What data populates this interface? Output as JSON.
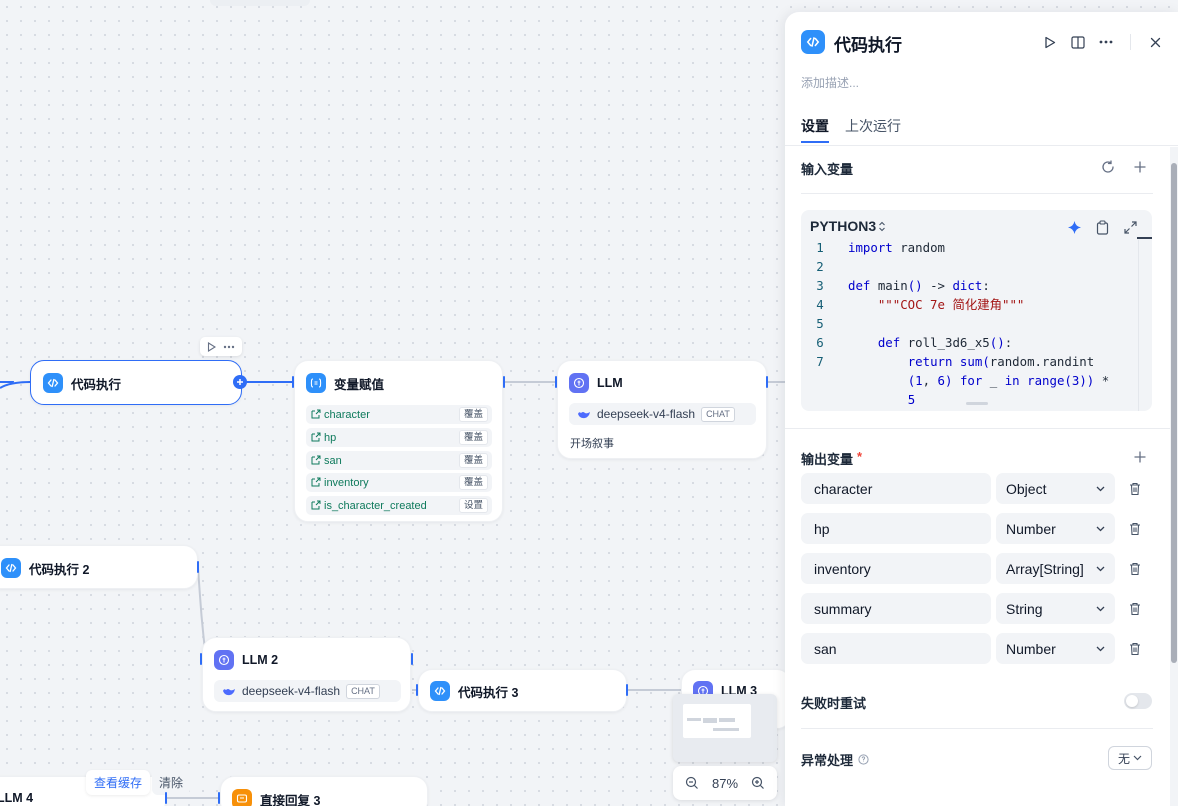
{
  "canvas": {
    "nodes": {
      "code1": {
        "title": "代码执行"
      },
      "assign": {
        "title": "变量赋值",
        "rows": [
          {
            "name": "character",
            "op": "覆盖"
          },
          {
            "name": "hp",
            "op": "覆盖"
          },
          {
            "name": "san",
            "op": "覆盖"
          },
          {
            "name": "inventory",
            "op": "覆盖"
          },
          {
            "name": "is_character_created",
            "op": "设置"
          }
        ]
      },
      "llm1": {
        "title": "LLM",
        "model": "deepseek-v4-flash",
        "mode": "CHAT",
        "desc": "开场叙事"
      },
      "code2": {
        "title": "代码执行 2"
      },
      "llm2": {
        "title": "LLM 2",
        "model": "deepseek-v4-flash",
        "mode": "CHAT"
      },
      "code3": {
        "title": "代码执行 3"
      },
      "llm3": {
        "title": "LLM 3"
      },
      "llm4": {
        "title": "LLM 4"
      },
      "reply3": {
        "title": "直接回复 3"
      }
    },
    "cache_link": "查看缓存",
    "clear_link": "清除",
    "zoom": "87%"
  },
  "panel": {
    "title": "代码执行",
    "description_placeholder": "添加描述...",
    "tabs": [
      {
        "label": "设置",
        "active": true
      },
      {
        "label": "上次运行",
        "active": false
      }
    ],
    "input_vars_label": "输入变量",
    "editor": {
      "language": "PYTHON3",
      "lines": [
        {
          "n": "1",
          "segs": [
            [
              "kw",
              "import"
            ],
            [
              "",
              " random"
            ]
          ]
        },
        {
          "n": "2",
          "segs": []
        },
        {
          "n": "3",
          "segs": [
            [
              "kw",
              "def"
            ],
            [
              "",
              " main"
            ],
            [
              "kw",
              "()"
            ],
            [
              "",
              " -> "
            ],
            [
              "kw",
              "dict"
            ],
            [
              "",
              ":"
            ]
          ]
        },
        {
          "n": "4",
          "segs": [
            [
              "",
              "    "
            ],
            [
              "str",
              "\"\"\"COC 7e 简化建角\"\"\""
            ]
          ]
        },
        {
          "n": "5",
          "segs": []
        },
        {
          "n": "6",
          "segs": [
            [
              "",
              "    "
            ],
            [
              "kw",
              "def"
            ],
            [
              "",
              " roll_3d6_x5"
            ],
            [
              "kw",
              "()"
            ],
            [
              "",
              ":"
            ]
          ]
        },
        {
          "n": "7",
          "segs": [
            [
              "",
              "        "
            ],
            [
              "kw",
              "return"
            ],
            [
              "",
              " "
            ],
            [
              "kw",
              "sum"
            ],
            [
              "kw",
              "("
            ],
            [
              "",
              "random.randint"
            ]
          ]
        },
        {
          "n": "",
          "segs": [
            [
              "",
              "        "
            ],
            [
              "kw",
              "(1"
            ],
            [
              "",
              ", "
            ],
            [
              "kw",
              "6"
            ],
            [
              "kw",
              ")"
            ],
            [
              "",
              " "
            ],
            [
              "kw",
              "for"
            ],
            [
              "",
              " _ "
            ],
            [
              "kw",
              "in"
            ],
            [
              "",
              " "
            ],
            [
              "kw",
              "range"
            ],
            [
              "kw",
              "(3))"
            ],
            [
              "",
              " *"
            ]
          ]
        },
        {
          "n": "",
          "segs": [
            [
              "",
              "        "
            ],
            [
              "kw",
              "5"
            ]
          ]
        }
      ]
    },
    "output_vars_label": "输出变量",
    "required_mark": "*",
    "outputs": [
      {
        "name": "character",
        "type": "Object"
      },
      {
        "name": "hp",
        "type": "Number"
      },
      {
        "name": "inventory",
        "type": "Array[String]"
      },
      {
        "name": "summary",
        "type": "String"
      },
      {
        "name": "san",
        "type": "Number"
      }
    ],
    "retry_label": "失败时重试",
    "retry_enabled": false,
    "error_label": "异常处理",
    "error_value": "无"
  },
  "colors": {
    "accent": "#2f6df6",
    "code_node_icon": "#2e90fa",
    "llm_node_icon": "#6172f3",
    "reply_node_icon": "#f79009",
    "variable_text": "#0e7a5c"
  }
}
